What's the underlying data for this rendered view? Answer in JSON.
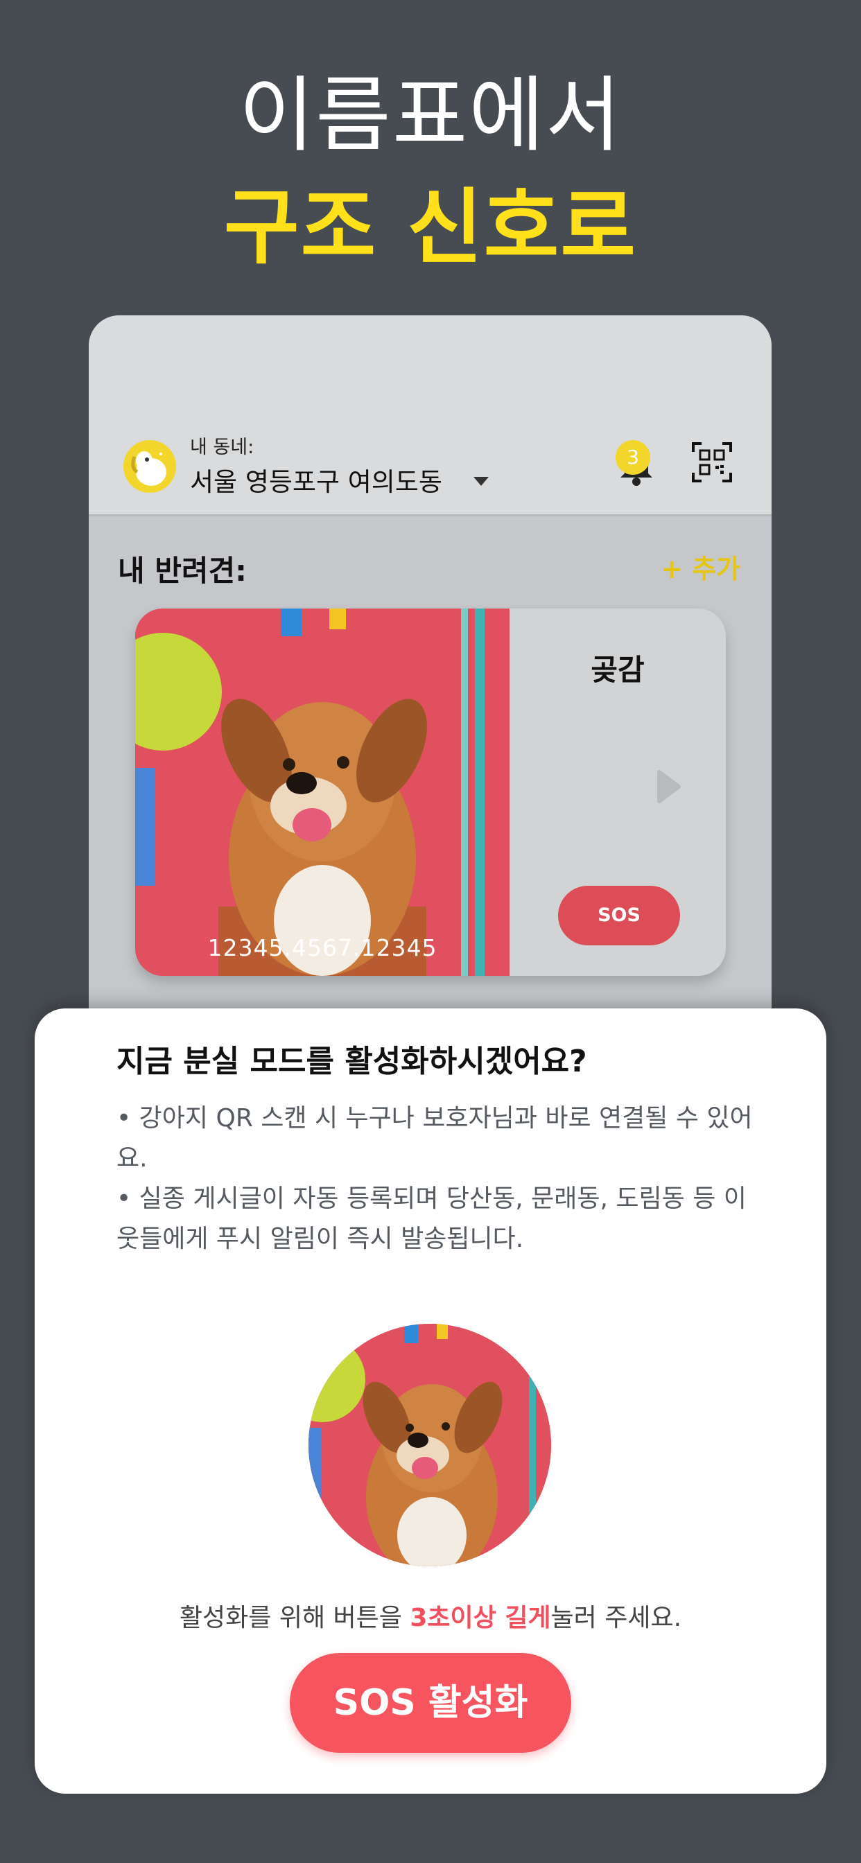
{
  "headline": {
    "line1": "이름표에서",
    "line2": "구조 신호로"
  },
  "app": {
    "location_label": "내 동네:",
    "location_value": "서울 영등포구 여의도동",
    "notification_count": "3",
    "pets_title": "내 반려견:",
    "add_label": "+ 추가",
    "pet": {
      "name": "곶감",
      "id_number": "12345.4567.12345",
      "sos_label": "SOS"
    }
  },
  "sheet": {
    "title": "지금 분실 모드를 활성화하시겠어요?",
    "bullet1": "• 강아지 QR 스캔 시 누구나 보호자님과 바로 연결될 수 있어요.",
    "bullet2": "• 실종 게시글이 자동 등록되며 당산동, 문래동, 도림동 등 이웃들에게 푸시 알림이 즉시 발송됩니다.",
    "hint_before": "활성화를 위해 버튼을 ",
    "hint_emphasis": "3초이상 길게",
    "hint_after": "눌러 주세요.",
    "button_label": "SOS 활성화"
  },
  "colors": {
    "background": "#474c52",
    "accent_yellow": "#ffe01a",
    "sos_red": "#f6545f"
  }
}
